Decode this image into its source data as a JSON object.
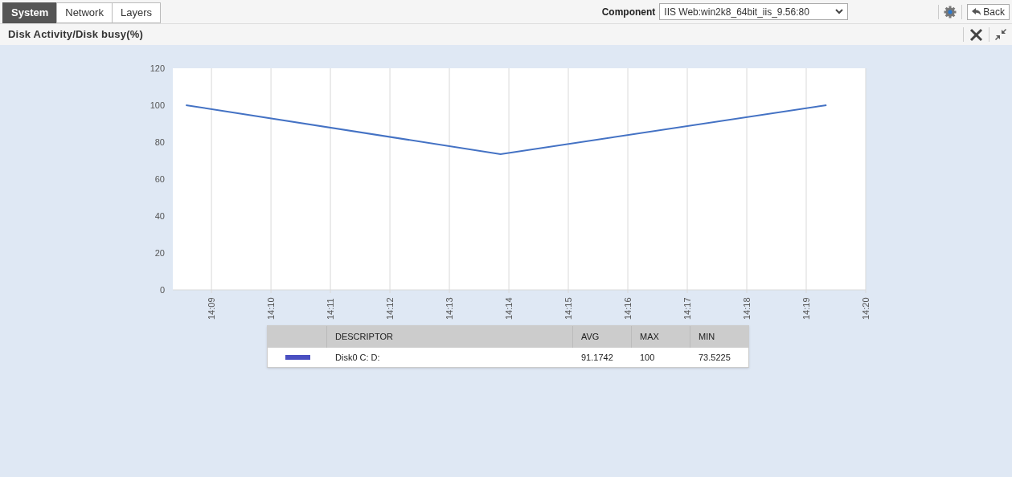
{
  "tabs": [
    {
      "label": "System",
      "selected": true
    },
    {
      "label": "Network",
      "selected": false
    },
    {
      "label": "Layers",
      "selected": false
    }
  ],
  "component": {
    "label": "Component",
    "value": "IIS Web:win2k8_64bit_iis_9.56:80"
  },
  "back_button": "Back",
  "panel": {
    "title": "Disk Activity/Disk busy(%)",
    "chart_data": {
      "type": "line",
      "x": [
        848.57,
        853.86,
        859.34
      ],
      "series": [
        {
          "name": "Disk0 C: D:",
          "color": "#4472c4",
          "values": [
            100,
            73.5,
            100
          ]
        }
      ],
      "xlim": [
        848.35,
        860
      ],
      "ylim": [
        0,
        120
      ],
      "xticks": [
        {
          "value": 849,
          "label": "14:09"
        },
        {
          "value": 850,
          "label": "14:10"
        },
        {
          "value": 851,
          "label": "14:11"
        },
        {
          "value": 852,
          "label": "14:12"
        },
        {
          "value": 853,
          "label": "14:13"
        },
        {
          "value": 854,
          "label": "14:14"
        },
        {
          "value": 855,
          "label": "14:15"
        },
        {
          "value": 856,
          "label": "14:16"
        },
        {
          "value": 857,
          "label": "14:17"
        },
        {
          "value": 858,
          "label": "14:18"
        },
        {
          "value": 859,
          "label": "14:19"
        },
        {
          "value": 860,
          "label": "14:20"
        }
      ],
      "yticks": [
        0,
        20,
        40,
        60,
        80,
        100,
        120
      ],
      "grid": true
    },
    "legend": {
      "columns": [
        "DESCRIPTOR",
        "AVG",
        "MAX",
        "MIN"
      ],
      "rows": [
        {
          "color": "#4a4fc1",
          "avg": "91.1742",
          "max": "100",
          "min": "73.5225"
        }
      ]
    }
  }
}
